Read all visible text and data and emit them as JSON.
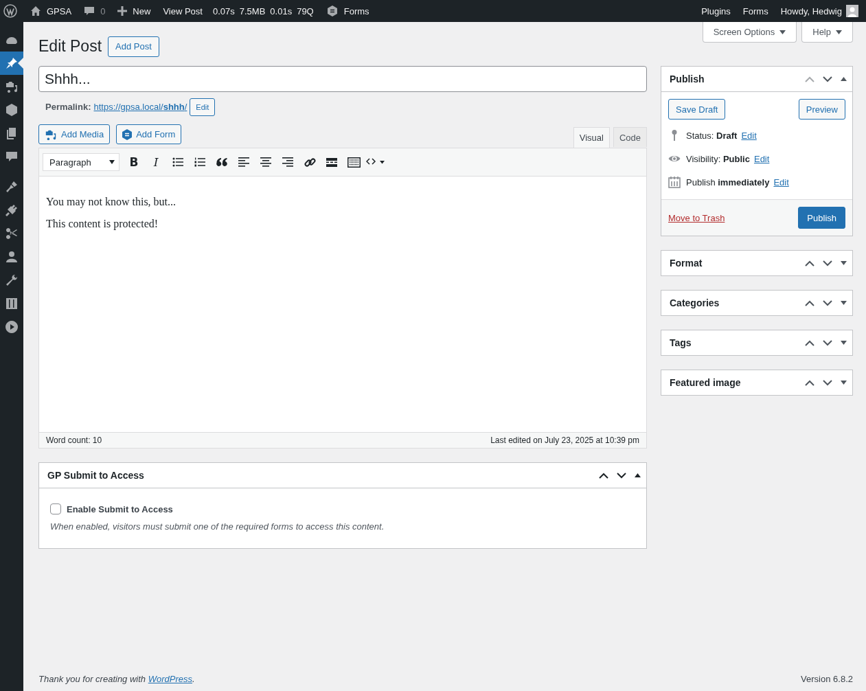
{
  "admin_bar": {
    "site": "GPSA",
    "comments": "0",
    "new": "New",
    "view_post": "View Post",
    "stats": [
      "0.07s",
      "7.5MB",
      "0.01s",
      "79Q"
    ],
    "forms": "Forms",
    "right_links": [
      "Plugins",
      "Forms"
    ],
    "howdy": "Howdy, Hedwig"
  },
  "sidebar": {
    "groups": [
      [
        {
          "selected": false
        },
        {
          "selected": true
        },
        {
          "selected": false
        },
        {
          "selected": false
        },
        {
          "selected": false
        },
        {
          "selected": false
        }
      ],
      [
        {
          "selected": false
        },
        {
          "selected": false
        },
        {
          "selected": false
        },
        {
          "selected": false
        },
        {
          "selected": false
        },
        {
          "selected": false
        },
        {
          "selected": false
        }
      ]
    ]
  },
  "screen_tabs": [
    "Screen Options",
    "Help"
  ],
  "heading": {
    "title": "Edit Post",
    "add_button": "Add Post"
  },
  "title_field": {
    "value": "Shhh..."
  },
  "permalink": {
    "label": "Permalink:",
    "url": "https://gpsa.local/**shhh**/",
    "edit": "Edit"
  },
  "media_buttons": [
    {
      "kind": "media",
      "label": "Add Media"
    },
    {
      "kind": "form",
      "label": "Add Form"
    }
  ],
  "editor_tabs": [
    {
      "label": "Visual",
      "selected": true
    },
    {
      "label": "Code",
      "selected": false
    }
  ],
  "toolbar": [
    {
      "kind": "select",
      "label": "Paragraph"
    },
    {
      "kind": "bold",
      "label": "B"
    },
    {
      "kind": "italic",
      "label": "I"
    },
    {
      "kind": "ul"
    },
    {
      "kind": "ol"
    },
    {
      "kind": "quote"
    },
    {
      "kind": "align-left"
    },
    {
      "kind": "align-center"
    },
    {
      "kind": "align-right"
    },
    {
      "kind": "link"
    },
    {
      "kind": "more"
    },
    {
      "kind": "keyboard"
    },
    {
      "kind": "code"
    }
  ],
  "content": [
    "You may not know this, but...",
    "This content is protected!"
  ],
  "status": {
    "word_count": "Word count: 10",
    "last_edited": "Last edited on July 23, 2025 at 10:39 pm"
  },
  "publish_box": {
    "title": "Publish",
    "expanded": true,
    "save_draft": "Save Draft",
    "preview": "Preview",
    "rows": [
      {
        "kind": "status",
        "text": "Status: **Draft**",
        "link": "Edit"
      },
      {
        "kind": "visibility",
        "text": "Visibility: **Public**",
        "link": "Edit"
      },
      {
        "kind": "schedule",
        "text": "Publish **immediately**",
        "link": "Edit"
      }
    ],
    "trash": "Move to Trash",
    "publish": "Publish"
  },
  "side_boxes": [
    {
      "title": "Format",
      "expanded": false
    },
    {
      "title": "Categories",
      "expanded": false
    },
    {
      "title": "Tags",
      "expanded": false
    },
    {
      "title": "Featured image",
      "expanded": false
    }
  ],
  "submit_box": {
    "title": "GP Submit to Access",
    "expanded": true,
    "checkbox": {
      "label": "Enable Submit to Access",
      "checked": false
    },
    "description": "When enabled, visitors must submit one of the required forms to access this content."
  },
  "footer": {
    "thanks": "Thank you for creating with",
    "link": "WordPress",
    "suffix": ".",
    "version": "Version 6.8.2"
  }
}
